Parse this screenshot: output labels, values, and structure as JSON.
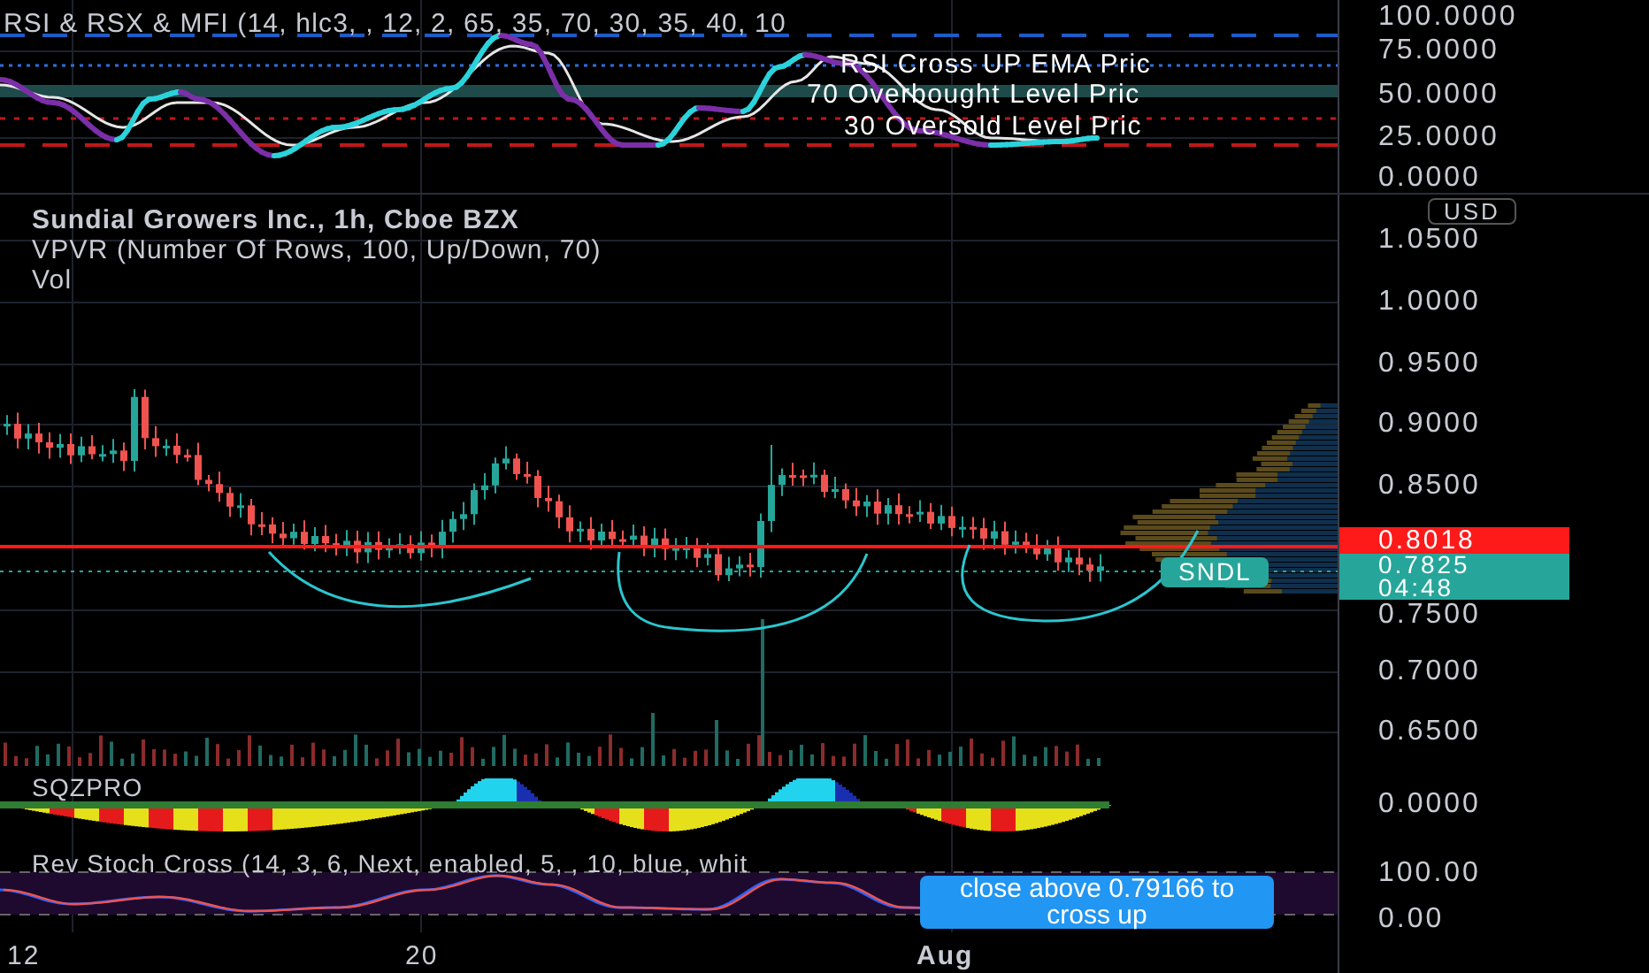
{
  "rsi_pane": {
    "legend": "RSI & RSX & MFI (14, hlc3, , 12, 2, 65, 35, 70, 30, 35, 40, 10",
    "line_labels": [
      "RSI Cross UP EMA Pric",
      "70 Overbought Level Pric",
      "30 Oversold Level Pric"
    ],
    "axis_labels": [
      "100.0000",
      "75.0000",
      "50.0000",
      "25.0000",
      "0.0000"
    ]
  },
  "main_pane": {
    "title": "Sundial Growers Inc., 1h, Cboe BZX",
    "indicators": [
      "VPVR (Number Of Rows, 100, Up/Down, 70)",
      "Vol"
    ],
    "currency": "USD",
    "axis_labels": [
      "1.0500",
      "1.0000",
      "0.9500",
      "0.9000",
      "0.8500",
      "0.7500",
      "0.7000",
      "0.6500"
    ],
    "line_price": "0.8018",
    "symbol": "SNDL",
    "last_price": "0.7825",
    "countdown": "04:48"
  },
  "sqz_pane": {
    "legend": "SQZPRO",
    "axis_labels": [
      "0.0000"
    ]
  },
  "stoch_pane": {
    "legend": "Rev Stoch Cross (14, 3, 6, Next, enabled, 5, , 10, blue, whit",
    "tooltip": "close above 0.79166 to cross up",
    "axis_labels": [
      "100.00",
      "0.00"
    ]
  },
  "time_axis": [
    "12",
    "20",
    "Aug"
  ]
}
